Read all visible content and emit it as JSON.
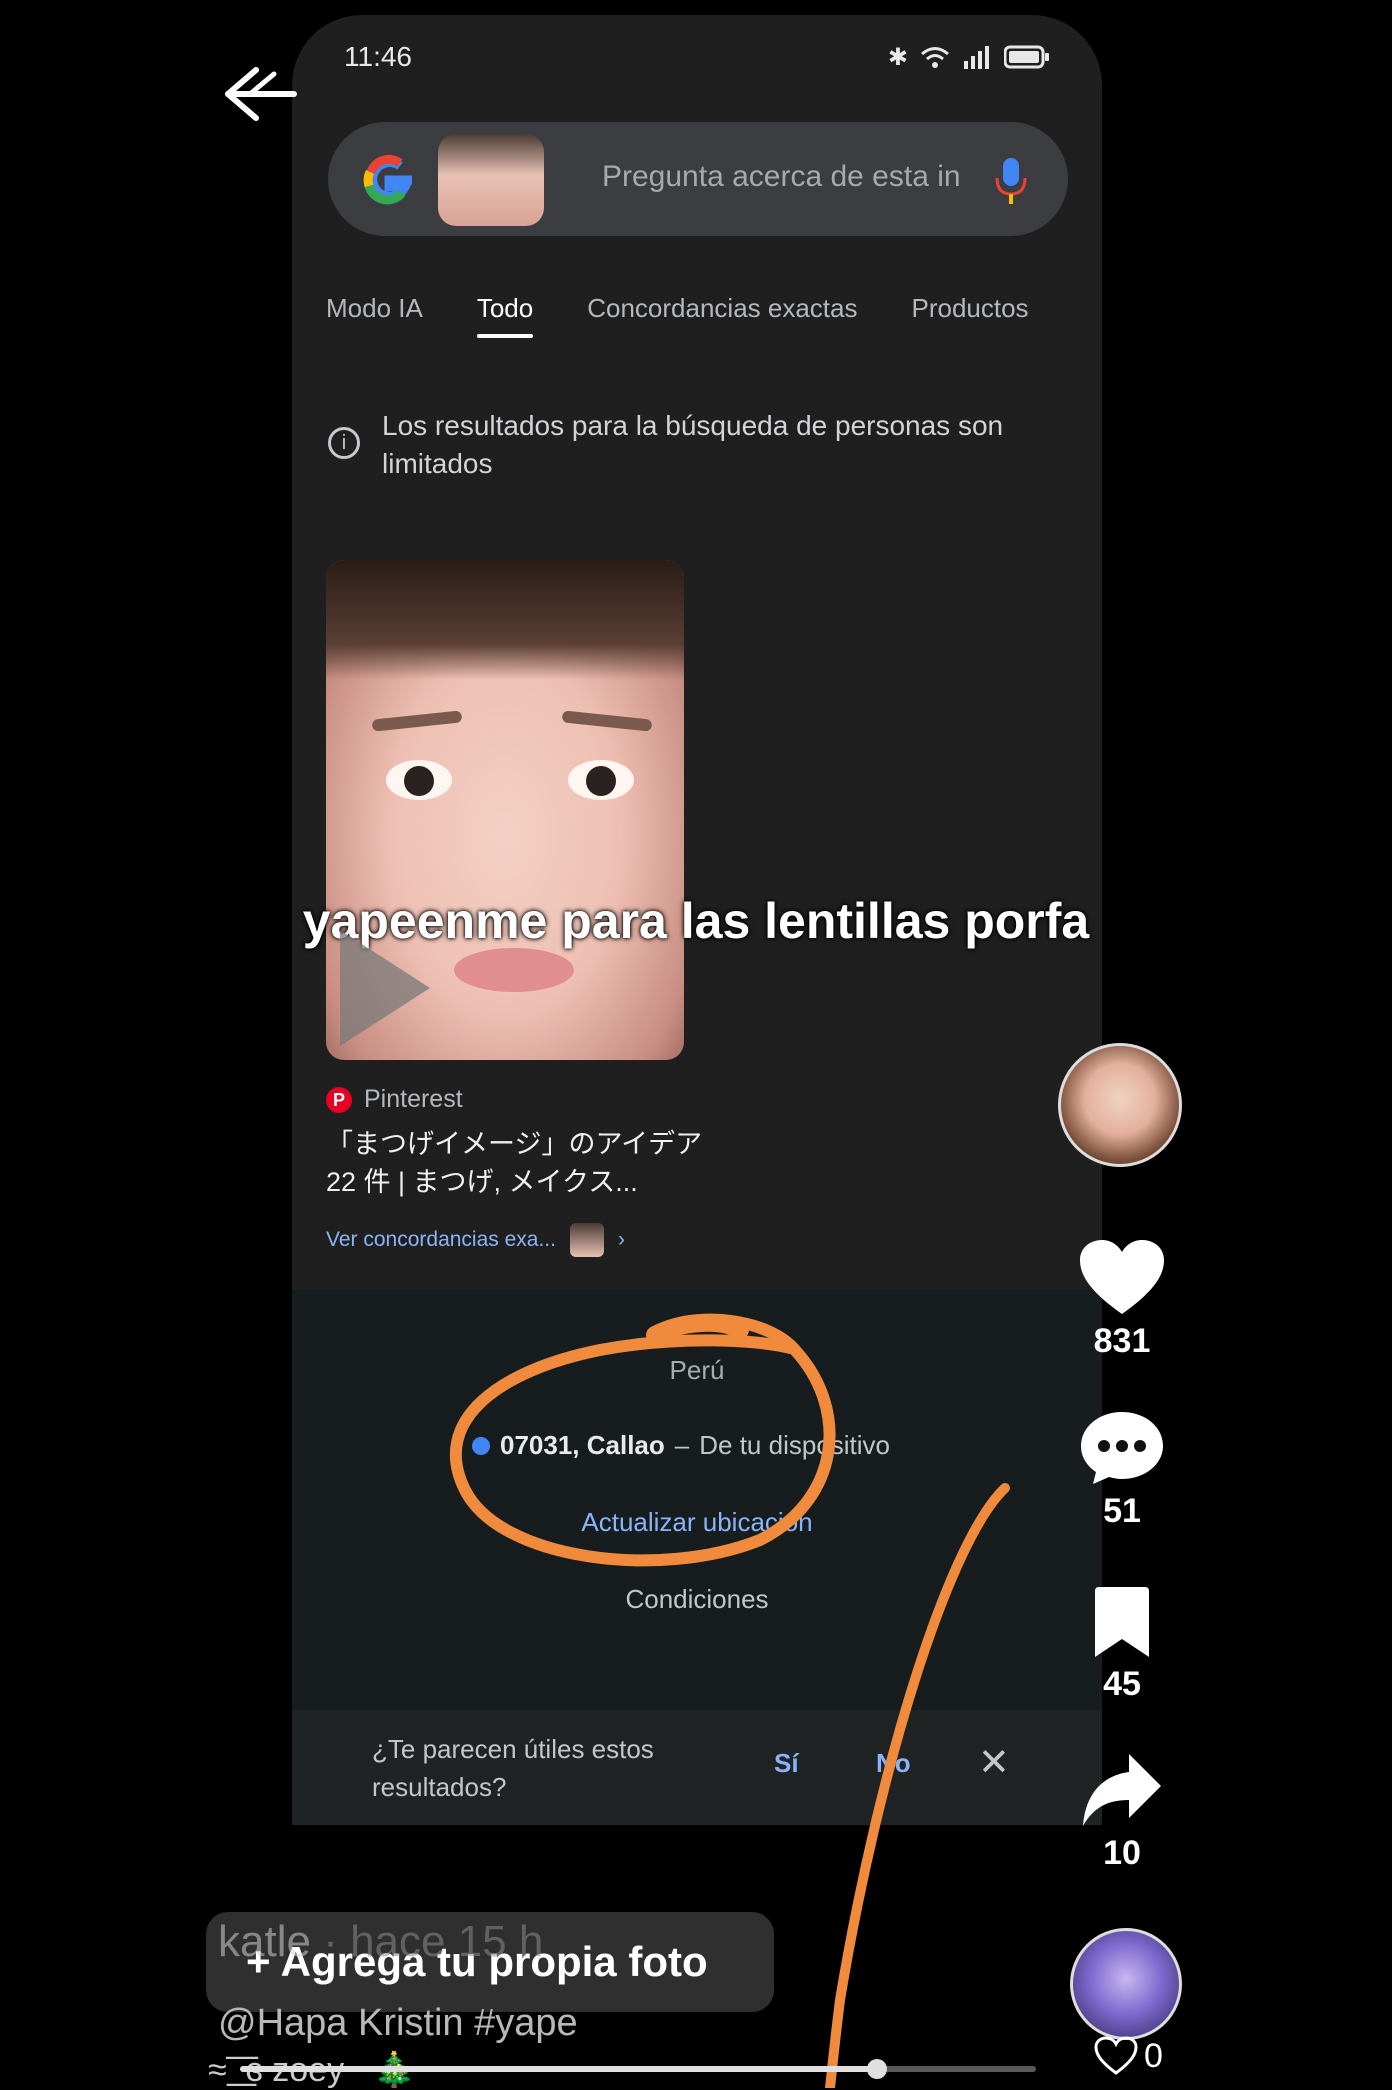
{
  "status_bar": {
    "time": "11:46",
    "icons": [
      "bluetooth-icon",
      "wifi-icon",
      "signal-icon",
      "battery-icon"
    ]
  },
  "search": {
    "placeholder": "Pregunta acerca de esta in"
  },
  "tabs": [
    {
      "label": "Modo IA",
      "active": false
    },
    {
      "label": "Todo",
      "active": true
    },
    {
      "label": "Concordancias exactas",
      "active": false
    },
    {
      "label": "Productos",
      "active": false
    }
  ],
  "notice": {
    "text": "Los resultados para la búsqueda de personas son limitados"
  },
  "result": {
    "source": "Pinterest",
    "title": "「まつげイメージ」のアイデア 22 件 | まつげ, メイクス...",
    "match_link": "Ver concordancias exa...",
    "chevron": "›"
  },
  "footer": {
    "country": "Perú",
    "location_code": "07031, Callao",
    "location_sep": " – ",
    "location_source": "De tu dispositivo",
    "update": "Actualizar ubicación",
    "terms": "Condiciones"
  },
  "feedback": {
    "question": "¿Te parecen útiles estos resultados?",
    "yes": "Sí",
    "no": "No",
    "close": "✕"
  },
  "overlay": {
    "caption": "yapeenme para las lentillas porfa"
  },
  "actions": {
    "likes": "831",
    "comments": "51",
    "saves": "45",
    "shares": "10"
  },
  "bottom": {
    "author": "katle",
    "time": "· hace 15 h",
    "add_photo": "+ Agrega tu propia foto",
    "caption": "@Hapa Kristin #yape",
    "music": "≈ ͟͟͞͞ ɞ zoey ~🎄",
    "like_count": "0",
    "progress": 0.8
  },
  "colors": {
    "accent_annotation": "#f08a3c",
    "link": "#8ab4f8",
    "like_heart": "#ffffff"
  }
}
